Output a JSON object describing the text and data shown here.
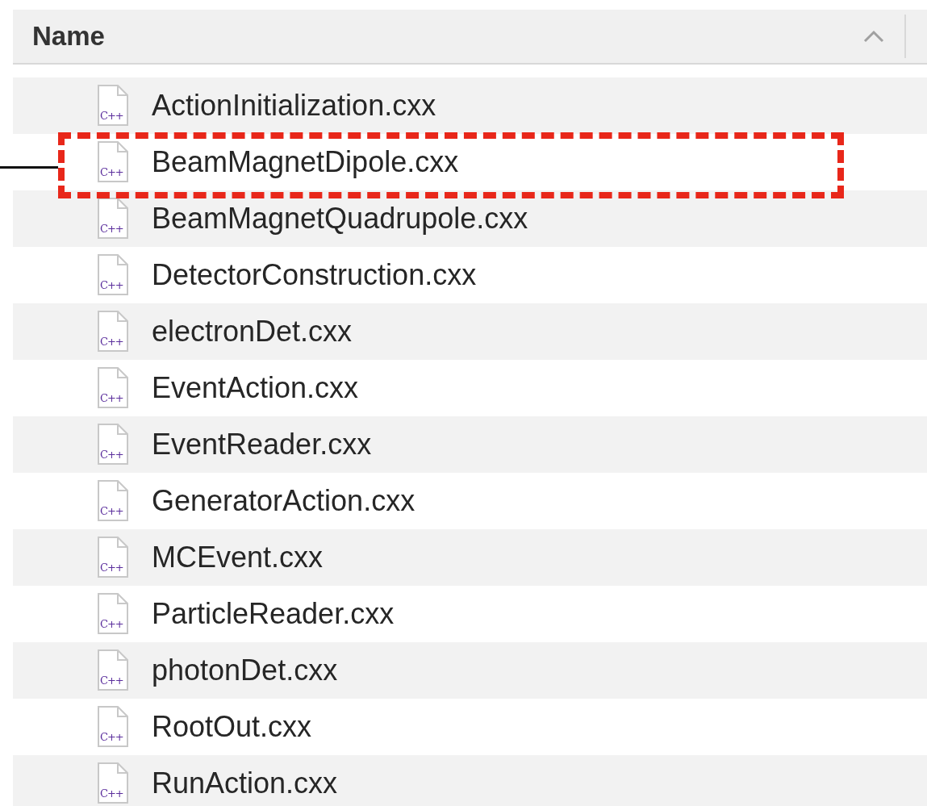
{
  "table": {
    "columns": [
      {
        "label": "Name",
        "sorted_ascending": true
      }
    ],
    "rows": [
      {
        "name": "ActionInitialization.cxx",
        "icon_label": "C++",
        "highlighted": false
      },
      {
        "name": "BeamMagnetDipole.cxx",
        "icon_label": "C++",
        "highlighted": true
      },
      {
        "name": "BeamMagnetQuadrupole.cxx",
        "icon_label": "C++",
        "highlighted": false
      },
      {
        "name": "DetectorConstruction.cxx",
        "icon_label": "C++",
        "highlighted": false
      },
      {
        "name": "electronDet.cxx",
        "icon_label": "C++",
        "highlighted": false
      },
      {
        "name": "EventAction.cxx",
        "icon_label": "C++",
        "highlighted": false
      },
      {
        "name": "EventReader.cxx",
        "icon_label": "C++",
        "highlighted": false
      },
      {
        "name": "GeneratorAction.cxx",
        "icon_label": "C++",
        "highlighted": false
      },
      {
        "name": "MCEvent.cxx",
        "icon_label": "C++",
        "highlighted": false
      },
      {
        "name": "ParticleReader.cxx",
        "icon_label": "C++",
        "highlighted": false
      },
      {
        "name": "photonDet.cxx",
        "icon_label": "C++",
        "highlighted": false
      },
      {
        "name": "RootOut.cxx",
        "icon_label": "C++",
        "highlighted": false
      },
      {
        "name": "RunAction.cxx",
        "icon_label": "C++",
        "highlighted": false
      }
    ]
  }
}
